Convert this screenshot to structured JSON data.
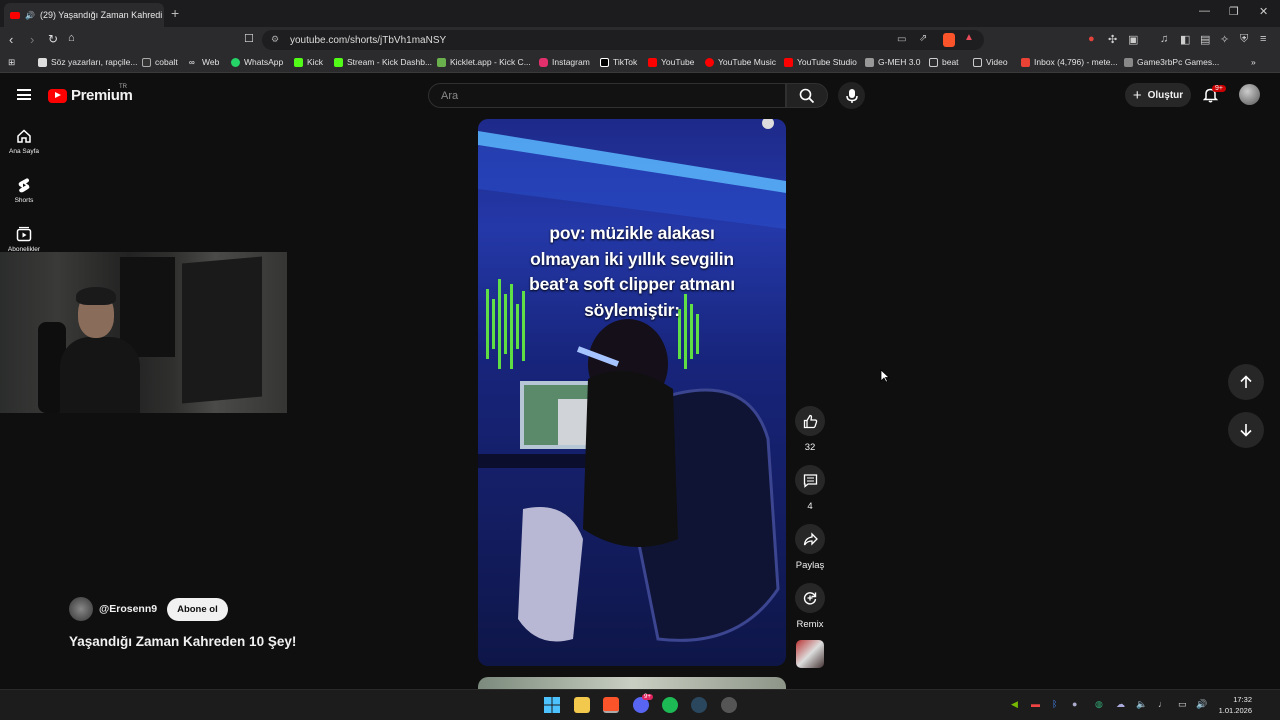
{
  "browser": {
    "tab_title": "(29) Yaşandığı Zaman Kahredi",
    "new_tab": "+",
    "url": "youtube.com/shorts/jTbVh1maNSY",
    "window_controls": [
      "—",
      "❐",
      "✕"
    ]
  },
  "bookmarks": [
    {
      "label": "Söz yazarları, rapçile...",
      "icon": "google-icon",
      "color": "#dddddd"
    },
    {
      "label": "cobalt",
      "icon": "cobalt-icon",
      "color": "#ffffff"
    },
    {
      "label": "Web",
      "icon": "infinity-icon",
      "color": "#ffffff"
    },
    {
      "label": "WhatsApp",
      "icon": "whatsapp-icon",
      "color": "#25d366"
    },
    {
      "label": "Kick",
      "icon": "kick-icon",
      "color": "#53fc18"
    },
    {
      "label": "Stream - Kick Dashb...",
      "icon": "kick-icon",
      "color": "#53fc18"
    },
    {
      "label": "Kicklet.app - Kick C...",
      "icon": "kicklet-icon",
      "color": "#6ab04c"
    },
    {
      "label": "Instagram",
      "icon": "instagram-icon",
      "color": "#e1306c"
    },
    {
      "label": "TikTok",
      "icon": "tiktok-icon",
      "color": "#ffffff"
    },
    {
      "label": "YouTube",
      "icon": "youtube-icon",
      "color": "#ff0000"
    },
    {
      "label": "YouTube Music",
      "icon": "youtube-music-icon",
      "color": "#ff0000"
    },
    {
      "label": "YouTube Studio",
      "icon": "youtube-studio-icon",
      "color": "#ff0000"
    },
    {
      "label": "G-MEH 3.0",
      "icon": "extension-icon",
      "color": "#cccccc"
    },
    {
      "label": "beat",
      "icon": "folder-icon",
      "color": "#cccccc"
    },
    {
      "label": "Video",
      "icon": "folder-icon",
      "color": "#cccccc"
    },
    {
      "label": "Inbox (4,796) - mete...",
      "icon": "gmail-icon",
      "color": "#ea4335"
    },
    {
      "label": "Game3rbPc Games...",
      "icon": "game-icon",
      "color": "#cccccc"
    }
  ],
  "youtube": {
    "logo_text": "Premium",
    "logo_region": "TR",
    "search_placeholder": "Ara",
    "create_label": "Oluştur",
    "notification_count": "9+",
    "sidebar": [
      {
        "label": "Ana Sayfa",
        "icon": "home-icon"
      },
      {
        "label": "Shorts",
        "icon": "shorts-icon"
      },
      {
        "label": "Abonelikler",
        "icon": "subscriptions-icon"
      }
    ]
  },
  "short": {
    "overlay_text": [
      "pov: müzikle alakası",
      "olmayan iki yıllık sevgilin",
      "beat’a soft clipper atmanı",
      "söylemiştir:"
    ],
    "channel": "@Erosenn9",
    "subscribe_label": "Abone ol",
    "title": "Yaşandığı Zaman Kahreden 10 Şey!",
    "likes": "32",
    "comments": "4",
    "share_label": "Paylaş",
    "remix_label": "Remix"
  },
  "taskbar": {
    "discord_badge": "9+",
    "time": "17:32",
    "date": "1.01.2026"
  },
  "colors": {
    "background": "#0f0f0f",
    "youtube_red": "#ff0000",
    "brave_orange": "#fb542b"
  }
}
